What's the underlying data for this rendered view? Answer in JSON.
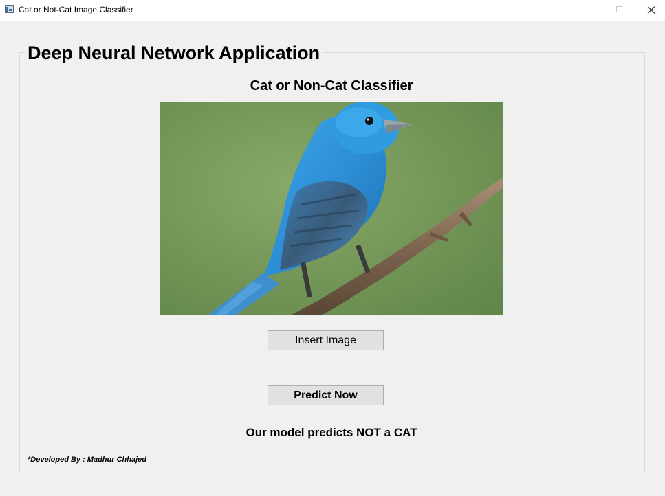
{
  "window": {
    "title": "Cat or Not-Cat Image Classifier",
    "controls": [
      "minimize-icon",
      "maximize-icon",
      "close-icon"
    ]
  },
  "group": {
    "title": "Deep Neural Network Application"
  },
  "main": {
    "subtitle": "Cat or Non-Cat Classifier",
    "image_description_icon": "bird-photo",
    "insert_button": "Insert Image",
    "predict_button": "Predict Now",
    "result": "Our model predicts NOT a CAT"
  },
  "footer": {
    "credit": "*Developed By : Madhur Chhajed"
  }
}
